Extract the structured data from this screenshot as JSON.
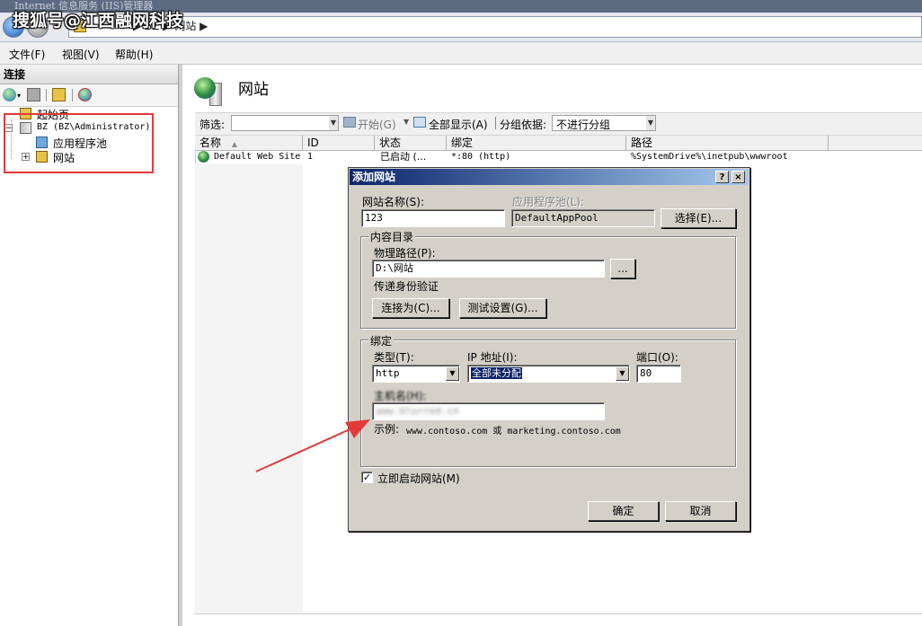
{
  "window": {
    "title": "Internet 信息服务 (IIS)管理器"
  },
  "watermark": "搜狐号@江西融网科技",
  "address": {
    "path": "▶ BZ ▶ 网站 ▶"
  },
  "menu": [
    "文件(F)",
    "视图(V)",
    "帮助(H)"
  ],
  "connections": {
    "header": "连接",
    "tree": [
      {
        "label": "起始页"
      },
      {
        "label": "BZ (BZ\\Administrator)"
      },
      {
        "label": "应用程序池"
      },
      {
        "label": "网站"
      }
    ]
  },
  "main": {
    "title": "网站",
    "filter": {
      "label": "筛选:",
      "start": "开始(G)",
      "show_all": "全部显示(A)",
      "group_by_label": "分组依据:",
      "group_by_value": "不进行分组"
    },
    "columns": [
      "名称",
      "ID",
      "状态",
      "绑定",
      "路径"
    ],
    "rows": [
      {
        "name": "Default Web Site",
        "id": "1",
        "status": "已启动 (...",
        "binding": "*:80 (http)",
        "path": "%SystemDrive%\\inetpub\\wwwroot"
      }
    ]
  },
  "dialog": {
    "title": "添加网站",
    "help_btn": "?",
    "close_btn": "×",
    "site_name_label": "网站名称(S):",
    "site_name_value": "123",
    "app_pool_label": "应用程序池(L):",
    "app_pool_value": "DefaultAppPool",
    "select_btn": "选择(E)...",
    "content_group": "内容目录",
    "phys_path_label": "物理路径(P):",
    "phys_path_value": "D:\\网站",
    "browse_btn": "...",
    "passthrough_label": "传递身份验证",
    "connect_as_btn": "连接为(C)...",
    "test_settings_btn": "测试设置(G)...",
    "binding_group": "绑定",
    "type_label": "类型(T):",
    "type_value": "http",
    "ip_label": "IP 地址(I):",
    "ip_value": "全部未分配",
    "port_label": "端口(O):",
    "port_value": "80",
    "hostname_label": "主机名(H):",
    "hostname_value": "www.blurred.cn",
    "example_label": "示例:",
    "example_text": "www.contoso.com 或 marketing.contoso.com",
    "start_now_label": "立即启动网站(M)",
    "ok_btn": "确定",
    "cancel_btn": "取消"
  },
  "colors": {
    "annotation_red": "#e33a3a",
    "dialog_title": "#0a246a"
  }
}
